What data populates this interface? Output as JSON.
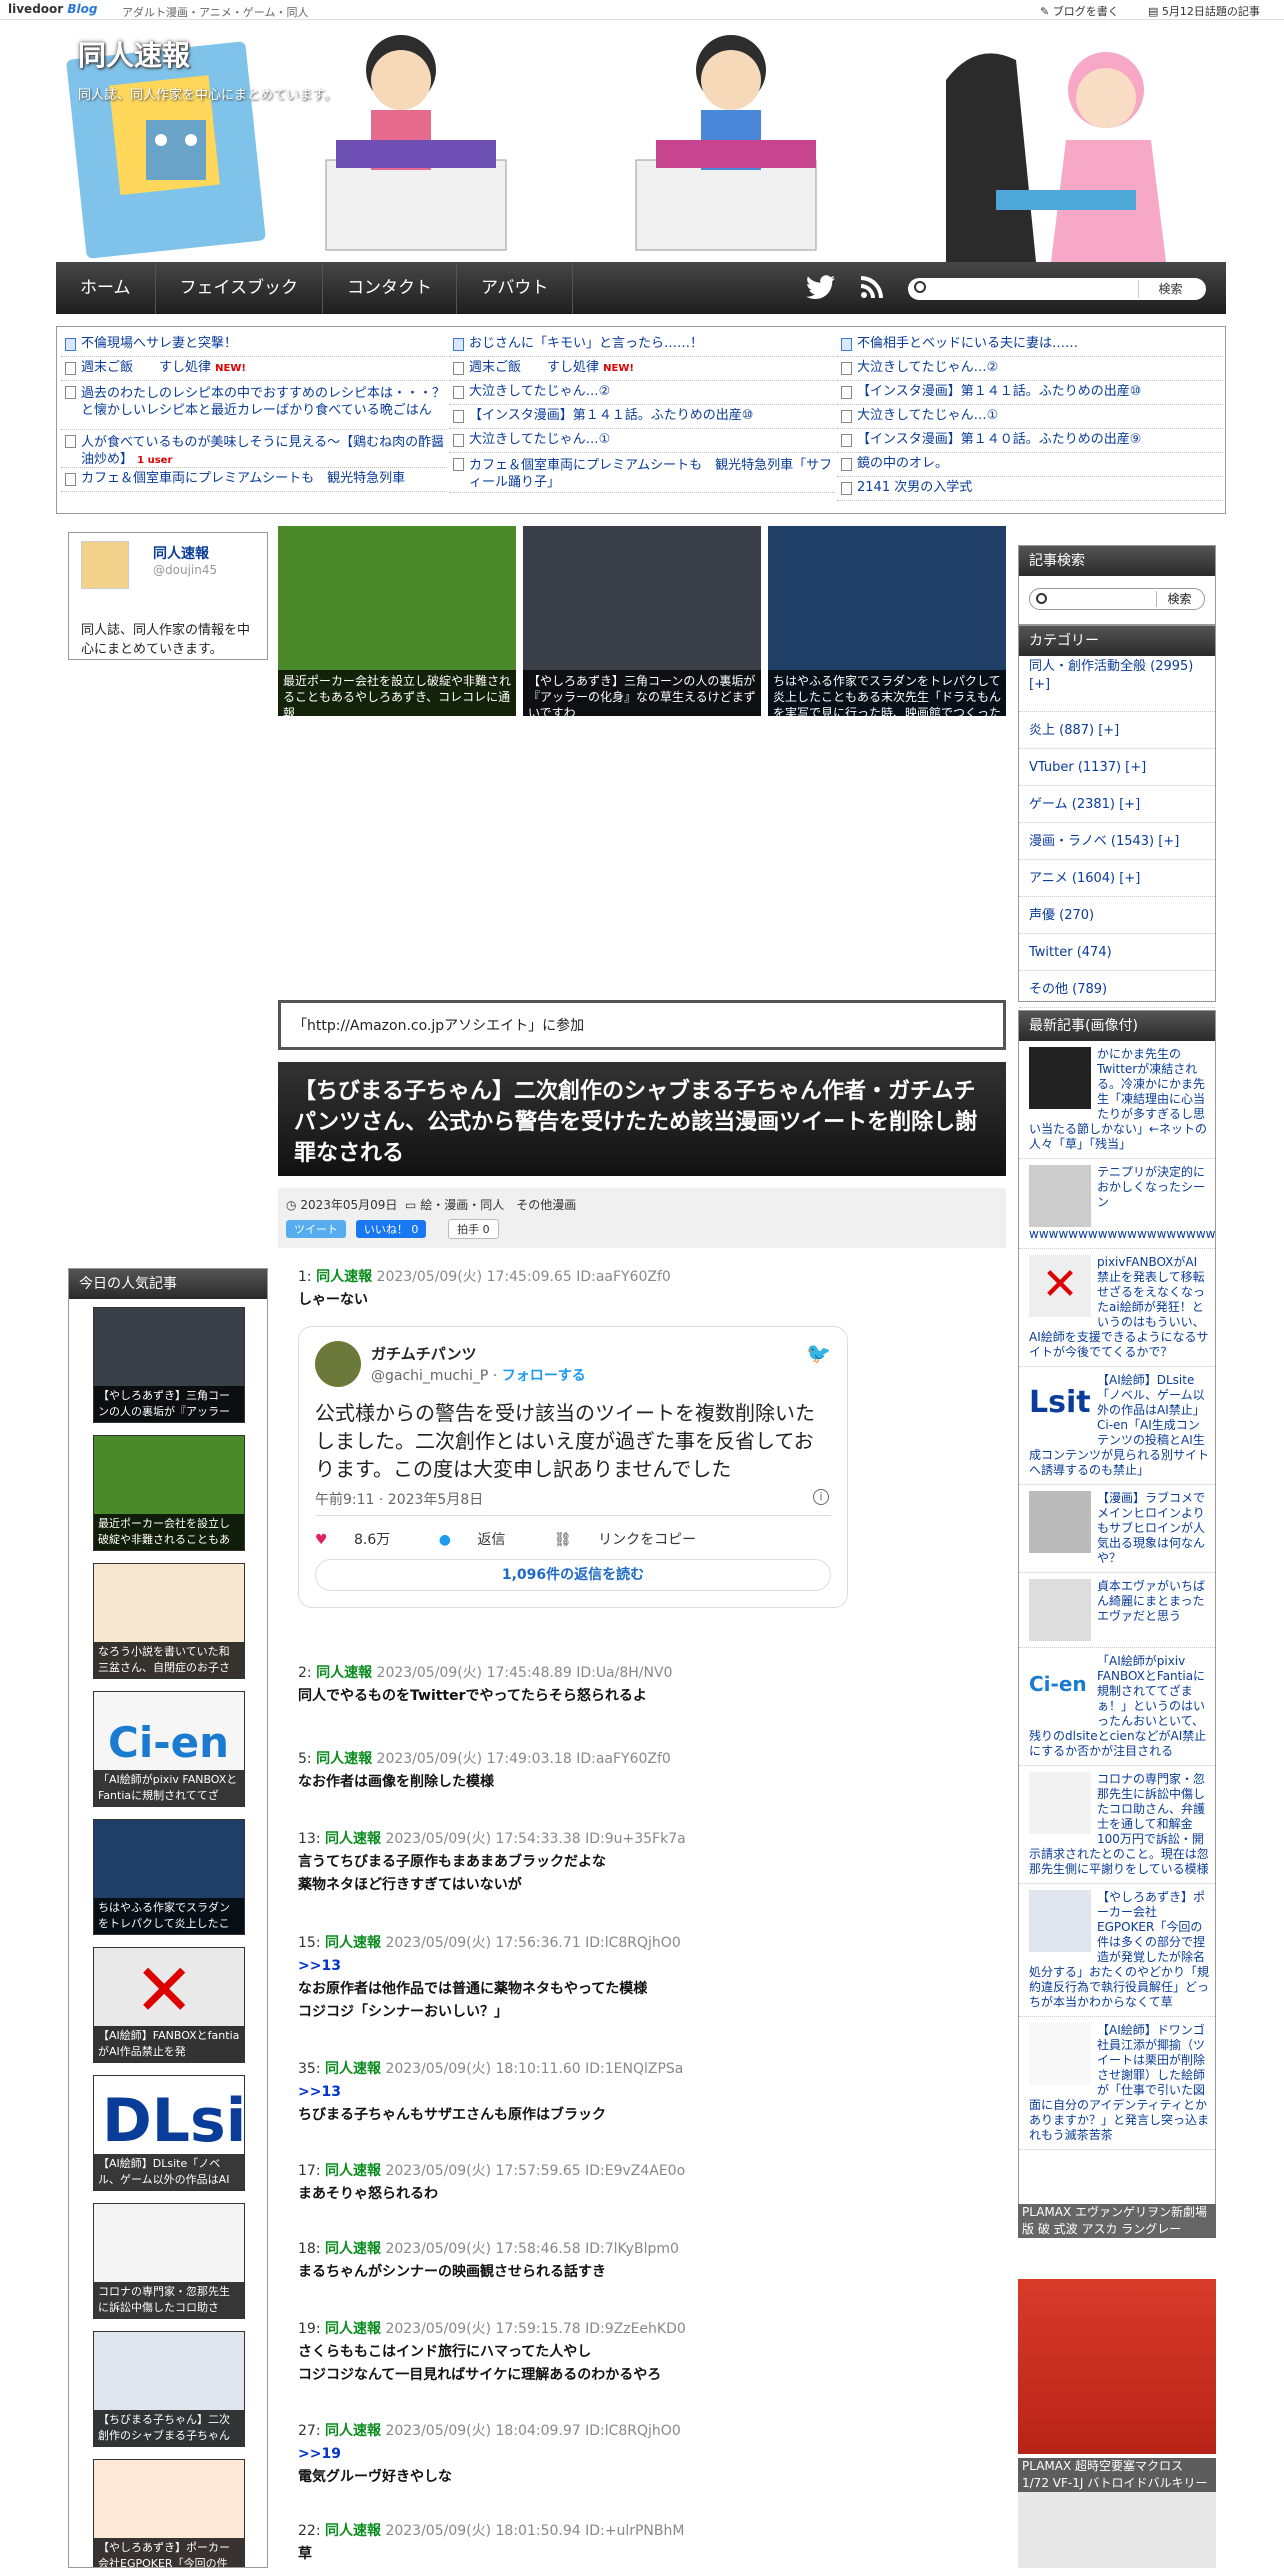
{
  "topbar": {
    "logo_a": "livedoor",
    "logo_b": "Blog",
    "categories": "アダルト漫画・アニメ・ゲーム・同人",
    "write": "ブログを書く",
    "topics": "5月12日話題の記事"
  },
  "header": {
    "title": "同人速報",
    "desc": "同人誌、同人作家を中心にまとめています。"
  },
  "nav": {
    "items": [
      "ホーム",
      "フェイスブック",
      "コンタクト",
      "アバウト"
    ],
    "search_button": "検索"
  },
  "ticker": {
    "col1": [
      "不倫現場へサレ妻と突撃！",
      "週末ご飯　　すし処律",
      "過去のわたしのレシピ本の中でおすすめのレシピ本は・・・？と懐かしいレシピ本と最近カレーばかり食べている晩ごはん",
      "人が食べているものが美味しそうに見える〜【鶏むね肉の酢醤油炒め】",
      "カフェ＆個室車両にプレミアムシートも　観光特急列車"
    ],
    "col2": [
      "おじさんに「キモい」と言ったら……！",
      "週末ご飯　　すし処律",
      "大泣きしてたじゃん…②",
      "【インスタ漫画】第１４１話。ふたりめの出産⑩",
      "大泣きしてたじゃん…①",
      "カフェ＆個室車両にプレミアムシートも　観光特急列車「サフィール踊り子」"
    ],
    "col3": [
      "不倫相手とベッドにいる夫に妻は……",
      "大泣きしてたじゃん…②",
      "【インスタ漫画】第１４１話。ふたりめの出産⑩",
      "大泣きしてたじゃん…①",
      "【インスタ漫画】第１４０話。ふたりめの出産⑨",
      "鏡の中のオレ。",
      "2141 次男の入学式"
    ],
    "new_label": "NEW!",
    "user_label": "1 user"
  },
  "profile": {
    "name": "同人速報",
    "id": "@doujin45",
    "text": "同人誌、同人作家の情報を中心にまとめていきます。"
  },
  "featured": [
    "最近ポーカー会社を設立し破綻や非難されることもあるやしろあずき、コレコレに通報",
    "【やしろあずき】三角コーンの人の裏垢が『アッラーの化身』なの草生えるけどまずいですわ",
    "ちはやふる作家でスラダンをトレパクして炎上したこともある末次先生「ドラえもんを実写で見に行った時、映画館でつくった"
  ],
  "amazon": "「http://Amazon.co.jpアソシエイト」に参加",
  "post": {
    "title": "【ちびまる子ちゃん】二次創作のシャブまる子ちゃん作者・ガチムチパンツさん、公式から警告を受けたため該当漫画ツイートを削除し謝罪なされる",
    "date": "2023年05月09日",
    "category": "絵・漫画・同人　その他漫画",
    "tweet_btn": "ツイート",
    "like_btn": "いいね！ 0",
    "clap_btn": "拍手 0"
  },
  "tweet": {
    "name": "ガチムチパンツ",
    "handle": "@gachi_muchi_P",
    "follow": "フォローする",
    "body": "公式様からの警告を受け該当のツイートを複数削除いたしました。二次創作とはいえ度が過ぎた事を反省しております。この度は大変申し訳ありませんでした",
    "time": "午前9:11 · 2023年5月8日",
    "likes": "8.6万",
    "reply": "返信",
    "copy": "リンクをコピー",
    "read_replies": "1,096件の返信を読む"
  },
  "responses": [
    {
      "num": "1:",
      "name": "同人速報",
      "date": "2023/05/09(火) 17:45:09.65 ID:aaFY60Zf0",
      "anchor": "",
      "body": [
        "しゃーない"
      ]
    },
    {
      "num": "2:",
      "name": "同人速報",
      "date": "2023/05/09(火) 17:45:48.89 ID:Ua/8H/NV0",
      "anchor": "",
      "body": [
        "同人でやるものをTwitterでやってたらそら怒られるよ"
      ]
    },
    {
      "num": "5:",
      "name": "同人速報",
      "date": "2023/05/09(火) 17:49:03.18 ID:aaFY60Zf0",
      "anchor": "",
      "body": [
        "なお作者は画像を削除した模様"
      ]
    },
    {
      "num": "13:",
      "name": "同人速報",
      "date": "2023/05/09(火) 17:54:33.38 ID:9u+35Fk7a",
      "anchor": "",
      "body": [
        "言うてちびまる子原作もまあまあブラックだよな",
        "薬物ネタほど行きすぎてはいないが"
      ]
    },
    {
      "num": "15:",
      "name": "同人速報",
      "date": "2023/05/09(火) 17:56:36.71 ID:lC8RQjhO0",
      "anchor": ">>13",
      "body": [
        "なお原作者は他作品では普通に薬物ネタもやってた模様",
        "コジコジ「シンナーおいしい？」"
      ]
    },
    {
      "num": "35:",
      "name": "同人速報",
      "date": "2023/05/09(火) 18:10:11.60 ID:1ENQlZPSa",
      "anchor": ">>13",
      "body": [
        "ちびまる子ちゃんもサザエさんも原作はブラック"
      ]
    },
    {
      "num": "17:",
      "name": "同人速報",
      "date": "2023/05/09(火) 17:57:59.65 ID:E9vZ4AE0o",
      "anchor": "",
      "body": [
        "まあそりゃ怒られるわ"
      ]
    },
    {
      "num": "18:",
      "name": "同人速報",
      "date": "2023/05/09(火) 17:58:46.58 ID:7lKyBlpm0",
      "anchor": "",
      "body": [
        "まるちゃんがシンナーの映画観させられる話すき"
      ]
    },
    {
      "num": "19:",
      "name": "同人速報",
      "date": "2023/05/09(火) 17:59:15.78 ID:9ZzEehKD0",
      "anchor": "",
      "body": [
        "さくらももこはインド旅行にハマってた人やし",
        "コジコジなんて一目見ればサイケに理解あるのわかるやろ"
      ]
    },
    {
      "num": "27:",
      "name": "同人速報",
      "date": "2023/05/09(火) 18:04:09.97 ID:lC8RQjhO0",
      "anchor": ">>19",
      "body": [
        "電気グルーヴ好きやしな"
      ]
    },
    {
      "num": "22:",
      "name": "同人速報",
      "date": "2023/05/09(火) 18:01:50.94 ID:+ulrPNBhM",
      "anchor": "",
      "body": [
        "草"
      ]
    }
  ],
  "popular": {
    "title": "今日の人気記事",
    "items": [
      "【やしろあずき】三角コーンの人の裏垢が『アッラー",
      "最近ポーカー会社を設立し破綻や非難されることもあ",
      "なろう小説を書いていた和三盆さん、自閉症のお子さ",
      "「AI絵師がpixiv FANBOXとFantiaに規制されててざ",
      "ちはやふる作家でスラダンをトレパクして炎上したこ",
      "【AI絵師】FANBOXとfantiaがAI作品禁止を発",
      "【AI絵師】DLsite「ノベル、ゲーム以外の作品はAI",
      "コロナの専門家・忽那先生に訴訟中傷したコロ助さ",
      "【ちびまる子ちゃん】二次創作のシャブまる子ちゃん",
      "【やしろあずき】ポーカー会社EGPOKER「今回の件"
    ]
  },
  "side_search": {
    "title": "記事検索",
    "button": "検索"
  },
  "categories": {
    "title": "カテゴリー",
    "items": [
      "同人・創作活動全般 (2995) [+]",
      "炎上 (887) [+]",
      "VTuber (1137) [+]",
      "ゲーム (2381) [+]",
      "漫画・ラノベ (1543) [+]",
      "アニメ (1604) [+]",
      "声優 (270)",
      "Twitter (474)",
      "その他 (789)"
    ]
  },
  "recent": {
    "title": "最新記事(画像付)",
    "items": [
      "かにかま先生のTwitterが凍結される。冷凍かにかま先生「凍結理由に心当たりが多すぎるし思い当たる節しかない」←ネットの人々「草」「残当」",
      "テニプリが決定的におかしくなったシーン wwwwwwwwwwwwwwwwwwwwwwwwwwwwwwwwwwwwwwwwwww",
      "pixivFANBOXがAI禁止を発表して移転せざるをえなくなったai絵師が発狂！というのはもういい、AI絵師を支援できるようになるサイトが今後でてくるかで？",
      "【AI絵師】DLsite「ノベル、ゲーム以外の作品はAI禁止」Ci-en「AI生成コンテンツの投稿とAI生成コンテンツが見られる別サイトへ誘導するのも禁止」",
      "【漫画】ラブコメでメインヒロインよりもサブヒロインが人気出る現象は何なんや？",
      "貞本エヴァがいちばん綺麗にまとまったエヴァだと思う",
      "「AI絵師がpixiv FANBOXとFantiaに規制されててざまぁ！」というのはいったんおいといて、残りのdlsiteとcienなどがAI禁止にするか否かが注目される",
      "コロナの専門家・忽那先生に訴訟中傷したコロ助さん、弁護士を通して和解金100万円で訴訟・開示請求されたとのこと。現在は忽那先生側に平謝りをしている模様",
      "【やしろあずき】ポーカー会社EGPOKER「今回の件は多くの部分で捏造が発覚したが除名処分する」おたくのやどかり「規約違反行為で執行役員解任」どっちが本当かわからなくて草",
      "【AI絵師】ドワンゴ社員江添が揶揄（ツイートは栗田が削除させ謝罪）した絵師が「仕事で引いた図面に自分のアイデンティティとかありますか？」と発言し突っ込まれもう滅茶苦茶"
    ]
  },
  "ads": [
    "PLAMAX エヴァンゲリヲン新劇場版 破 式波 アスカ ラングレー",
    "PLAMAX 超時空要塞マクロス 1/72 VF-1J バトロイドバルキリー"
  ]
}
